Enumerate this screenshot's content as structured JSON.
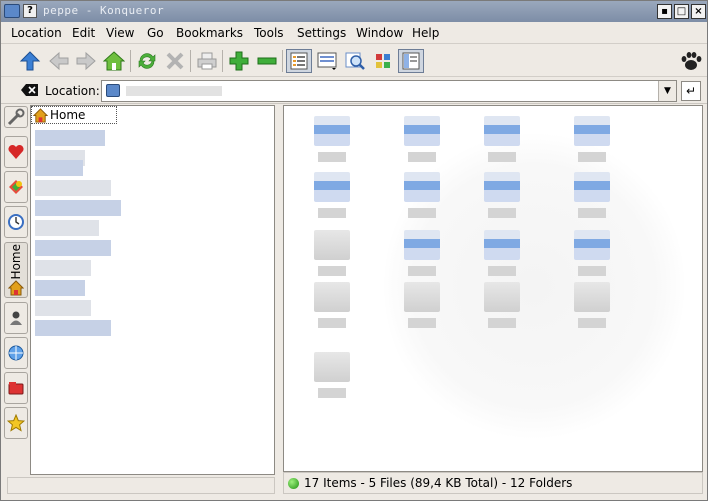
{
  "window": {
    "title": "peppe - Konqueror",
    "help_button": "?",
    "minimize": "▪",
    "maximize": "□",
    "close": "×"
  },
  "menubar": {
    "items": [
      "Location",
      "Edit",
      "View",
      "Go",
      "Bookmarks",
      "Tools",
      "Settings",
      "Window",
      "Help"
    ]
  },
  "toolbar": {
    "buttons": [
      "up-icon",
      "back-icon",
      "forward-icon",
      "home-icon",
      "reload-icon",
      "stop-icon",
      "print-icon",
      "zoom-in-icon",
      "zoom-out-icon",
      "icon-view-icon",
      "detail-view-icon",
      "find-icon",
      "color-icon",
      "split-view-icon"
    ]
  },
  "location": {
    "label": "Location:",
    "value": ""
  },
  "sidebar": {
    "tabs": [
      "config-icon",
      "bookmarks-icon",
      "services-icon",
      "history-icon",
      "Home",
      "home-folder-icon",
      "system-icon",
      "network-icon",
      "devices-icon",
      "favorites-icon"
    ],
    "home_label": "Home"
  },
  "tree": {
    "root": "Home"
  },
  "status": {
    "text": "17 Items - 5 Files (89,4 KB Total) - 12 Folders"
  },
  "colors": {
    "accent": "#7d8da6",
    "folder": "#7fa9e3",
    "status_ok": "#2bb61a"
  }
}
